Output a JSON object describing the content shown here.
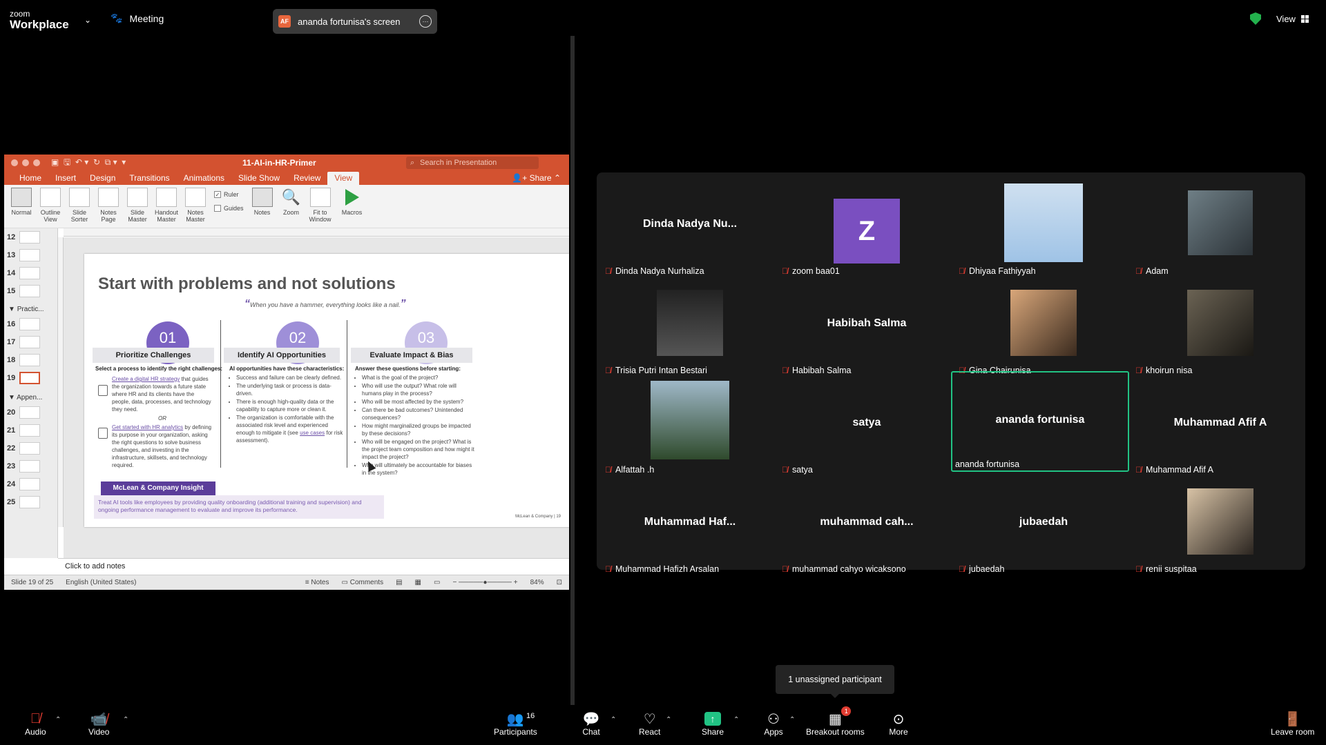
{
  "top": {
    "logo_top": "zoom",
    "logo_bottom": "Workplace",
    "meeting_label": "Meeting",
    "screen_initials": "AF",
    "screen_label": "ananda fortunisa's screen",
    "view_label": "View"
  },
  "ppt": {
    "doc_title": "11-AI-in-HR-Primer",
    "search_placeholder": "Search in Presentation",
    "tabs": [
      "Home",
      "Insert",
      "Design",
      "Transitions",
      "Animations",
      "Slide Show",
      "Review",
      "View"
    ],
    "share_label": "Share",
    "ribbon": [
      "Normal",
      "Outline View",
      "Slide Sorter",
      "Notes Page",
      "Slide Master",
      "Handout Master",
      "Notes Master"
    ],
    "ruler_label": "Ruler",
    "guides_label": "Guides",
    "notes_btn": "Notes",
    "zoom_btn": "Zoom",
    "fit_btn": "Fit to Window",
    "macros_btn": "Macros",
    "thumb_numbers": [
      "12",
      "13",
      "14",
      "15",
      "16",
      "17",
      "18",
      "19",
      "20",
      "21",
      "22",
      "23",
      "24",
      "25"
    ],
    "section_practice": "Practic...",
    "section_appendix": "Appen...",
    "slide": {
      "title": "Start with problems and not solutions",
      "quote": "When you have a hammer, everything looks like a nail.",
      "columns": [
        {
          "num": "01",
          "head": "Prioritize Challenges",
          "sub": "Select a process to identify the right challenges:"
        },
        {
          "num": "02",
          "head": "Identify AI Opportunities",
          "sub": "AI opportunities have these characteristics:"
        },
        {
          "num": "03",
          "head": "Evaluate Impact & Bias",
          "sub": "Answer these questions before starting:"
        }
      ],
      "col1_link1": "Create a digital HR strategy",
      "col1_text1": "that guides the organization towards a future state where HR and its clients have the people, data, processes, and technology they need.",
      "col1_or": "OR",
      "col1_link2": "Get started with HR analytics",
      "col1_text2": "by defining its purpose in your organization, asking the right questions to solve business challenges, and investing in the infrastructure, skillsets, and technology required.",
      "col2_items": [
        "Success and failure can be clearly defined.",
        "The underlying task or process is data-driven.",
        "There is enough high-quality data or the capability to capture more or clean it."
      ],
      "col2_last_a": "The organization is comfortable with the associated risk level and experienced enough to mitigate it (see",
      "col2_last_link": "use cases",
      "col2_last_b": "for risk assessment).",
      "col3_items": [
        "What is the goal of the project?",
        "Who will use the output? What role will humans play in the process?",
        "Who will be most affected by the system?",
        "Can there be bad outcomes? Unintended consequences?",
        "How might marginalized groups be impacted by these decisions?",
        "Who will be engaged on the project? What is the project team composition and how might it impact the project?",
        "Who will ultimately be accountable for biases in the system?"
      ],
      "insight_title": "McLean & Company Insight",
      "insight_text": "Treat AI tools like employees by providing quality onboarding (additional training and supervision) and ongoing performance management to evaluate and improve its performance.",
      "copyright": "McLean & Company | 19"
    },
    "notes_placeholder": "Click to add notes",
    "status_slide": "Slide 19 of 25",
    "status_lang": "English (United States)",
    "status_notes": "Notes",
    "status_comments": "Comments",
    "zoom_pct": "84%"
  },
  "participants": [
    {
      "display": "Dinda Nadya Nu...",
      "label": "Dinda Nadya Nurhaliza"
    },
    {
      "display": "Z",
      "label": "zoom baa01"
    },
    {
      "display": "",
      "label": "Dhiyaa Fathiyyah"
    },
    {
      "display": "",
      "label": "Adam"
    },
    {
      "display": "",
      "label": "Trisia Putri Intan Bestari"
    },
    {
      "display": "Habibah Salma",
      "label": "Habibah Salma"
    },
    {
      "display": "",
      "label": "Gina Chairunisa"
    },
    {
      "display": "",
      "label": "khoirun nisa"
    },
    {
      "display": "",
      "label": "Alfattah .h"
    },
    {
      "display": "satya",
      "label": "satya"
    },
    {
      "display": "ananda fortunisa",
      "label": "ananda fortunisa"
    },
    {
      "display": "Muhammad Afif A",
      "label": "Muhammad Afif A"
    },
    {
      "display": "Muhammad Haf...",
      "label": "Muhammad Hafizh Arsalan"
    },
    {
      "display": "muhammad cah...",
      "label": "muhammad cahyo wicaksono"
    },
    {
      "display": "jubaedah",
      "label": "jubaedah"
    },
    {
      "display": "",
      "label": "renii suspitaa"
    }
  ],
  "tooltip": "1 unassigned participant",
  "toolbar": {
    "audio": "Audio",
    "video": "Video",
    "participants": "Participants",
    "participant_count": "16",
    "chat": "Chat",
    "react": "React",
    "share": "Share",
    "apps": "Apps",
    "breakout": "Breakout rooms",
    "breakout_badge": "1",
    "more": "More",
    "leave": "Leave room"
  },
  "colors": {
    "ppt_accent": "#d35230",
    "zoom_active": "#21c384",
    "muted": "#e03c31",
    "avatar_z": "#7a4fc0"
  }
}
